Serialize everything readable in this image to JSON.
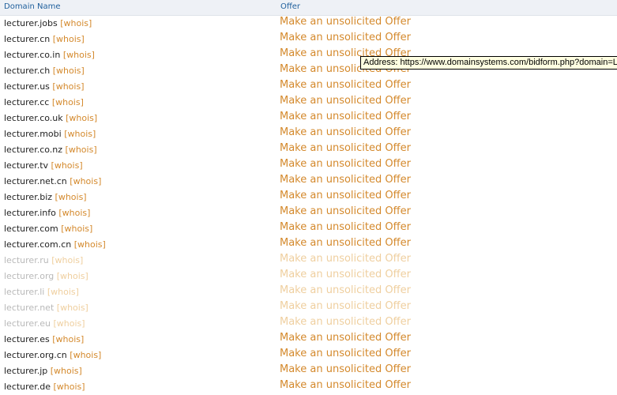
{
  "header": {
    "domain_col": "Domain Name",
    "offer_col": "Offer"
  },
  "whois_label": "[whois]",
  "offer_label": "Make an unsolicited Offer",
  "rows": [
    {
      "domain": "lecturer.jobs",
      "faded": false
    },
    {
      "domain": "lecturer.cn",
      "faded": false
    },
    {
      "domain": "lecturer.co.in",
      "faded": false
    },
    {
      "domain": "lecturer.ch",
      "faded": false
    },
    {
      "domain": "lecturer.us",
      "faded": false
    },
    {
      "domain": "lecturer.cc",
      "faded": false
    },
    {
      "domain": "lecturer.co.uk",
      "faded": false
    },
    {
      "domain": "lecturer.mobi",
      "faded": false
    },
    {
      "domain": "lecturer.co.nz",
      "faded": false
    },
    {
      "domain": "lecturer.tv",
      "faded": false
    },
    {
      "domain": "lecturer.net.cn",
      "faded": false
    },
    {
      "domain": "lecturer.biz",
      "faded": false
    },
    {
      "domain": "lecturer.info",
      "faded": false
    },
    {
      "domain": "lecturer.com",
      "faded": false
    },
    {
      "domain": "lecturer.com.cn",
      "faded": false
    },
    {
      "domain": "lecturer.ru",
      "faded": true
    },
    {
      "domain": "lecturer.org",
      "faded": true
    },
    {
      "domain": "lecturer.li",
      "faded": true
    },
    {
      "domain": "lecturer.net",
      "faded": true
    },
    {
      "domain": "lecturer.eu",
      "faded": true
    },
    {
      "domain": "lecturer.es",
      "faded": false
    },
    {
      "domain": "lecturer.org.cn",
      "faded": false
    },
    {
      "domain": "lecturer.jp",
      "faded": false
    },
    {
      "domain": "lecturer.de",
      "faded": false
    }
  ],
  "tooltip": {
    "text": "Address: https://www.domainsystems.com/bidform.php?domain=L"
  },
  "colors": {
    "accent": "#d4892c",
    "header_text": "#1f5f9c",
    "header_bg": "#eef1f6"
  }
}
